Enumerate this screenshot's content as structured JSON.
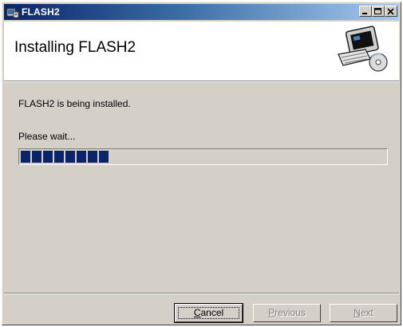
{
  "window": {
    "title": "FLASH2",
    "icon": "installer-app-icon",
    "controls": [
      "minimize-icon",
      "maximize-icon",
      "close-icon"
    ]
  },
  "header": {
    "title": "Installing FLASH2",
    "graphic": "computer-with-cd-icon"
  },
  "body": {
    "status": "FLASH2 is being installed.",
    "wait": "Please wait...",
    "progress_fraction": 0.24
  },
  "buttons": {
    "cancel": {
      "mnemonic": "C",
      "rest": "ancel"
    },
    "previous": {
      "mnemonic": "P",
      "rest": "revious"
    },
    "next": {
      "mnemonic": "N",
      "rest": "ext"
    }
  },
  "colors": {
    "title_gradient_start": "#0a246a",
    "title_gradient_end": "#a6caf0",
    "dialog_face": "#d4d0c8",
    "progress_fill": "#0a246a"
  }
}
